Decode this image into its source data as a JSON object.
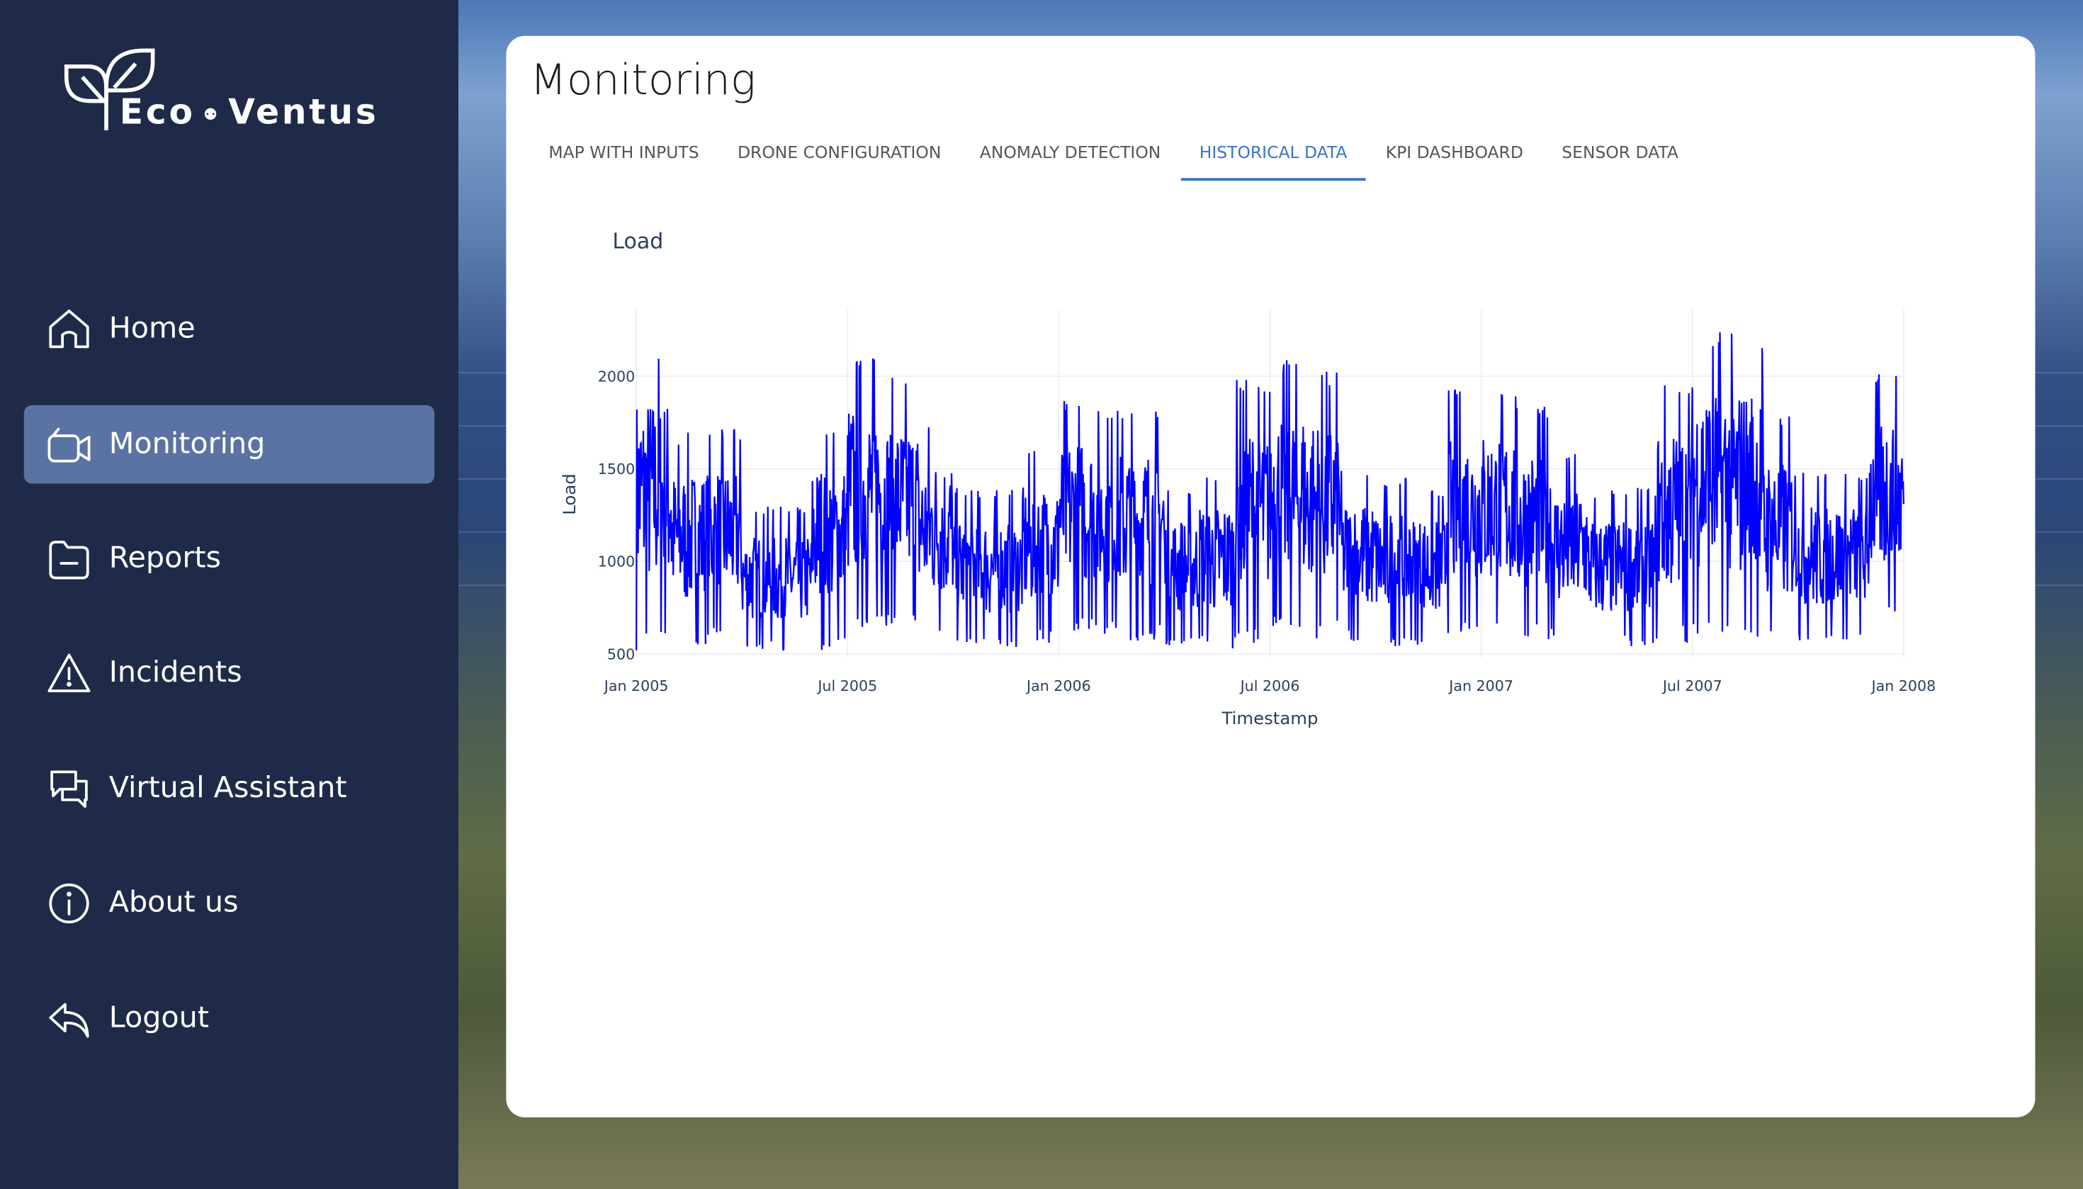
{
  "brand": {
    "name_left": "Eco",
    "name_right": "Ventus"
  },
  "sidebar": {
    "items": [
      {
        "label": "Home",
        "icon": "home-icon"
      },
      {
        "label": "Monitoring",
        "icon": "video-camera-icon",
        "active": true
      },
      {
        "label": "Reports",
        "icon": "folder-icon"
      },
      {
        "label": "Incidents",
        "icon": "warning-icon"
      },
      {
        "label": "Virtual Assistant",
        "icon": "chat-icon"
      },
      {
        "label": "About us",
        "icon": "info-icon"
      },
      {
        "label": "Logout",
        "icon": "logout-icon"
      }
    ]
  },
  "page": {
    "title": "Monitoring",
    "tabs": [
      "MAP WITH INPUTS",
      "DRONE CONFIGURATION",
      "ANOMALY DETECTION",
      "HISTORICAL DATA",
      "KPI DASHBOARD",
      "SENSOR DATA"
    ],
    "active_tab": 3
  },
  "colors": {
    "sidebar": "#1f2a48",
    "active_nav": "#5a73a3",
    "accent": "#3a73c9",
    "series": "#0000ff"
  },
  "chart_data": {
    "type": "line",
    "title": "Load",
    "xlabel": "Timestamp",
    "ylabel": "Load",
    "ylim": [
      480,
      2360
    ],
    "x_ticks": [
      "Jan 2005",
      "Jul 2005",
      "Jan 2006",
      "Jul 2006",
      "Jan 2007",
      "Jul 2007",
      "Jan 2008"
    ],
    "y_ticks": [
      500,
      1000,
      1500,
      2000
    ],
    "grid": true,
    "series": [
      {
        "name": "Load",
        "resolution": "monthly envelope (Jan 2005 - Dec 2007)",
        "monthly_high": [
          2200,
          1700,
          1720,
          1300,
          1300,
          1750,
          2150,
          2000,
          1800,
          1400,
          1400,
          1600,
          1900,
          1850,
          1850,
          1400,
          1500,
          2000,
          2100,
          2050,
          1500,
          1450,
          1400,
          1950,
          1950,
          1850,
          1600,
          1400,
          1400,
          2000,
          2280,
          2250,
          1800,
          1500,
          1500,
          2020
        ],
        "monthly_low": [
          520,
          550,
          580,
          520,
          520,
          520,
          600,
          650,
          560,
          540,
          530,
          560,
          620,
          600,
          570,
          540,
          530,
          560,
          600,
          580,
          560,
          540,
          550,
          600,
          620,
          580,
          560,
          540,
          540,
          560,
          600,
          580,
          560,
          560,
          560,
          700
        ]
      }
    ]
  }
}
